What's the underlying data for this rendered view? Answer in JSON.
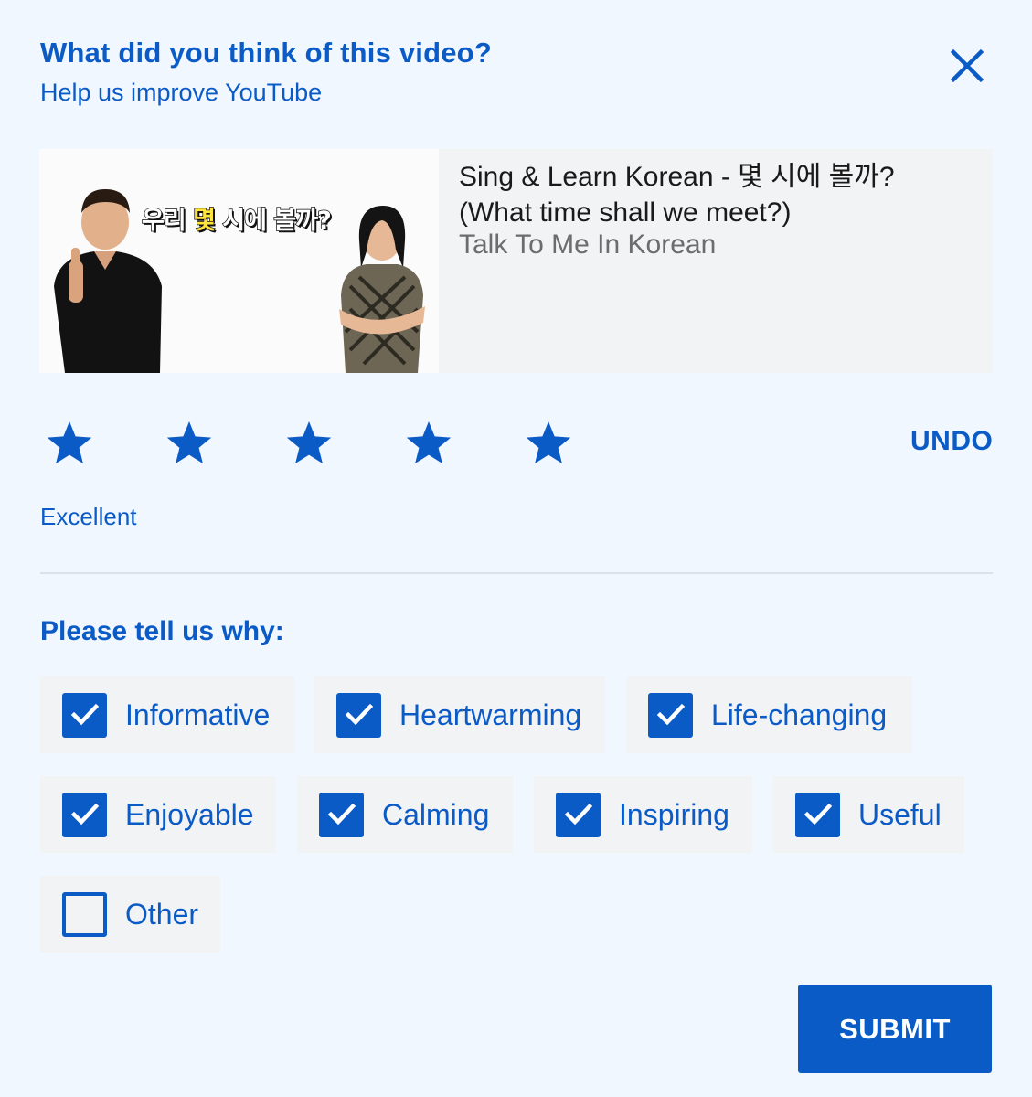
{
  "header": {
    "title": "What did you think of this video?",
    "subtitle": "Help us improve YouTube",
    "close_icon": "close-icon"
  },
  "video": {
    "title": "Sing & Learn Korean - 몇 시에 볼까? (What time shall we meet?)",
    "channel": "Talk To Me In Korean",
    "thumbnail_caption": {
      "part1": "우리 ",
      "highlight": "몇",
      "part2": " 시에 볼까?"
    }
  },
  "rating": {
    "stars": 5,
    "max_stars": 5,
    "label": "Excellent",
    "undo_label": "UNDO",
    "star_color": "#0b5bc7"
  },
  "reasons": {
    "heading": "Please tell us why:",
    "options": [
      {
        "label": "Informative",
        "checked": true
      },
      {
        "label": "Heartwarming",
        "checked": true
      },
      {
        "label": "Life-changing",
        "checked": true
      },
      {
        "label": "Enjoyable",
        "checked": true
      },
      {
        "label": "Calming",
        "checked": true
      },
      {
        "label": "Inspiring",
        "checked": true
      },
      {
        "label": "Useful",
        "checked": true
      },
      {
        "label": "Other",
        "checked": false
      }
    ]
  },
  "actions": {
    "submit_label": "SUBMIT"
  },
  "colors": {
    "accent": "#0b5bc7",
    "background": "#f1f7fe",
    "chip_background": "#f2f3f5"
  }
}
